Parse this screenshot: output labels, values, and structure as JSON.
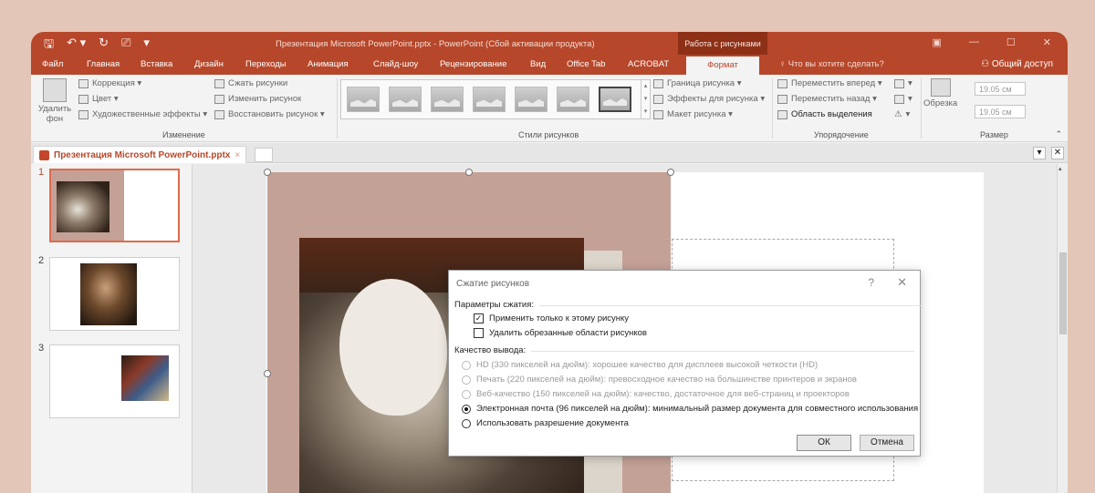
{
  "app": {
    "doc_title": "Презентация Microsoft PowerPoint.pptx - PowerPoint (Сбой активации продукта)",
    "context_tab": "Работа с рисунками"
  },
  "qat": {
    "save_icon": "save-icon",
    "undo_icon": "undo-icon",
    "redo_icon": "redo-icon",
    "customize_icon": "customize-qat-icon"
  },
  "window_controls": {
    "minimize": "—",
    "maximize": "☐",
    "close": "✕"
  },
  "tabs": [
    "Файл",
    "Главная",
    "Вставка",
    "Дизайн",
    "Переходы",
    "Анимация",
    "Слайд-шоу",
    "Рецензирование",
    "Вид",
    "Office Tab",
    "ACROBAT",
    "Формат"
  ],
  "active_tab": "Формат",
  "tell_me": "Что вы хотите сделать?",
  "share": "Общий доступ",
  "ribbon": {
    "remove_bg": "Удалить фон",
    "correction": "Коррекция ▾",
    "color": "Цвет ▾",
    "art_effects": "Художественные эффекты ▾",
    "compress": "Сжать рисунки",
    "change": "Изменить рисунок",
    "reset": "Восстановить рисунок ▾",
    "group_adjust": "Изменение",
    "group_styles": "Стили рисунков",
    "border": "Граница рисунка ▾",
    "effects": "Эффекты для рисунка ▾",
    "layout": "Макет рисунка ▾",
    "bring_forward": "Переместить вперед ▾",
    "send_backward": "Переместить назад ▾",
    "selection_pane": "Область выделения",
    "group_arrange": "Упорядочение",
    "crop": "Обрезка",
    "height": "19.05 см",
    "width": "19.05 см",
    "group_size": "Размер"
  },
  "doc_tab": {
    "label": "Презентация Microsoft PowerPoint.pptx",
    "close": "×"
  },
  "slides": [
    {
      "number": "1",
      "active": true
    },
    {
      "number": "2",
      "active": false
    },
    {
      "number": "3",
      "active": false
    }
  ],
  "dialog": {
    "title": "Сжатие рисунков",
    "help": "?",
    "close": "✕",
    "section_compression": "Параметры сжатия:",
    "apply_only": "Применить только к этому рисунку",
    "delete_cropped": "Удалить обрезанные области рисунков",
    "section_output": "Качество вывода:",
    "opt_hd": "HD (330 пикселей на дюйм): хорошее качество для дисплеев высокой четкости (HD)",
    "opt_print": "Печать (220 пикселей на дюйм): превосходное качество на большинстве принтеров и экранов",
    "opt_web": "Веб-качество (150 пикселей на дюйм): качество, достаточное для веб-страниц и проекторов",
    "opt_email": "Электронная почта (96 пикселей на дюйм): минимальный размер документа для совместного использования",
    "opt_doc": "Использовать разрешение документа",
    "ok": "ОК",
    "cancel": "Отмена"
  }
}
